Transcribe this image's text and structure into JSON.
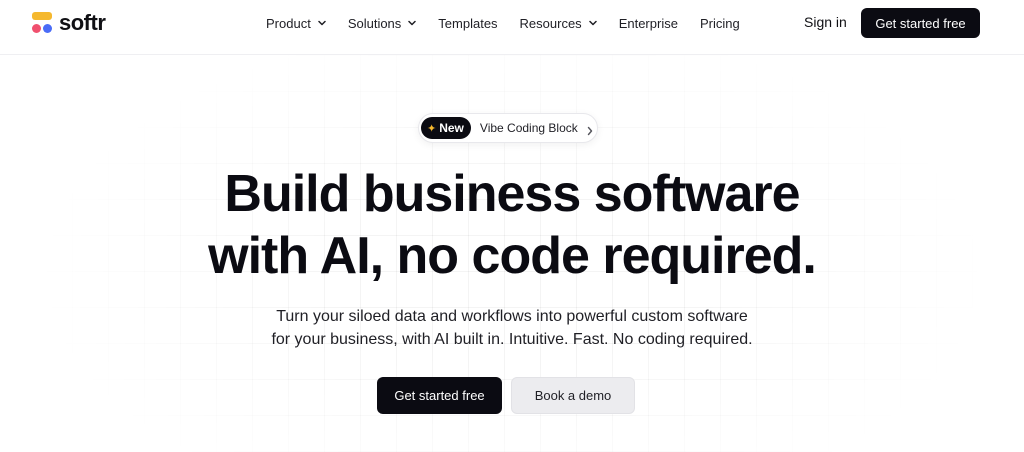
{
  "brand": {
    "name": "softr"
  },
  "nav": {
    "items": [
      {
        "label": "Product",
        "has_dropdown": true
      },
      {
        "label": "Solutions",
        "has_dropdown": true
      },
      {
        "label": "Templates",
        "has_dropdown": false
      },
      {
        "label": "Resources",
        "has_dropdown": true
      },
      {
        "label": "Enterprise",
        "has_dropdown": false
      },
      {
        "label": "Pricing",
        "has_dropdown": false
      }
    ],
    "sign_in": "Sign in",
    "cta": "Get started free"
  },
  "hero": {
    "announcement": {
      "badge": "New",
      "text": "Vibe Coding Block"
    },
    "headline": [
      "Build business software",
      "with AI, no code required."
    ],
    "subtitle": [
      "Turn your siloed data and workflows into powerful custom software",
      "for your business, with AI built in. Intuitive. Fast. No coding required."
    ],
    "primary_cta": "Get started free",
    "secondary_cta": "Book a demo"
  },
  "colors": {
    "dark": "#0b0b12",
    "logo_yellow": "#f5b82e",
    "logo_red": "#f0506e",
    "logo_blue": "#4a6cf7",
    "secondary_button": "#ececef"
  },
  "icons": [
    "chevron-down-icon",
    "chevron-right-icon",
    "sparkle-icon"
  ]
}
